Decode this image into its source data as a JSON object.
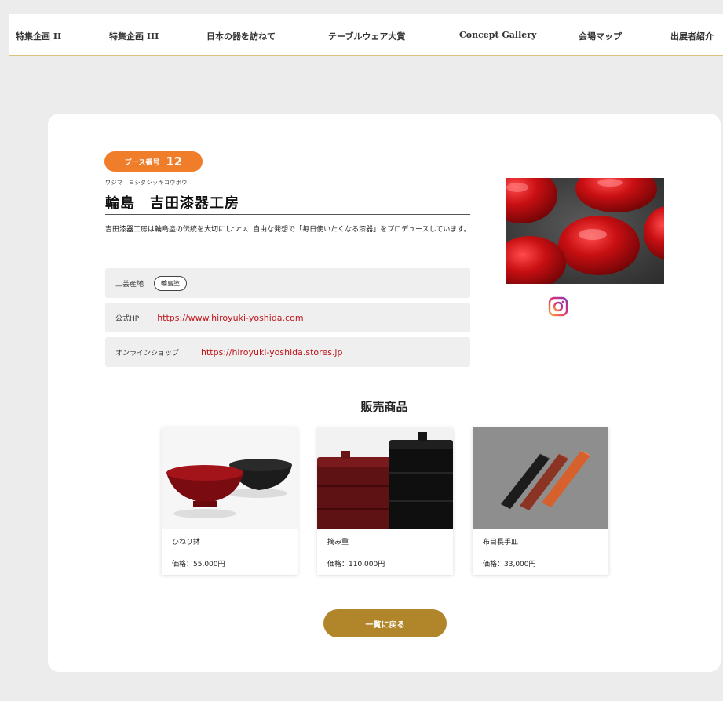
{
  "nav": {
    "items": [
      {
        "label": "特集企画 II"
      },
      {
        "label": "特集企画 III"
      },
      {
        "label": "日本の器を訪ねて"
      },
      {
        "label": "テーブルウェア大賞"
      },
      {
        "label": "Concept Gallery"
      },
      {
        "label": "会場マップ"
      },
      {
        "label": "出展者紹介"
      }
    ]
  },
  "exhibitor": {
    "booth_label": "ブース番号",
    "booth_number": "12",
    "kana": "ワジマ　ヨシダシッキコウボウ",
    "name": "輪島　吉田漆器工房",
    "description": "吉田漆器工房は輪島塗の伝統を大切にしつつ、自由な発想で「毎日使いたくなる漆器」をプロデュースしています。",
    "craft_label": "工芸産地",
    "craft_value": "輪島塗",
    "hp_label": "公式HP",
    "hp_url": "https://www.hiroyuki-yoshida.com",
    "shop_label": "オンラインショップ",
    "shop_url": "https://hiroyuki-yoshida.stores.jp"
  },
  "products_section": {
    "title": "販売商品",
    "items": [
      {
        "name": "ひねり鉢",
        "price": "価格：55,000円"
      },
      {
        "name": "摘み重",
        "price": "価格：110,000円"
      },
      {
        "name": "布目長手皿",
        "price": "価格：33,000円"
      }
    ]
  },
  "back_button": {
    "label": "一覧に戻る"
  },
  "colors": {
    "booth_badge": "#ef7d2a",
    "link": "#c0141a",
    "button": "#b1862a",
    "nav_underline": "#d9c27a"
  },
  "icons": {
    "social": "instagram-icon"
  }
}
